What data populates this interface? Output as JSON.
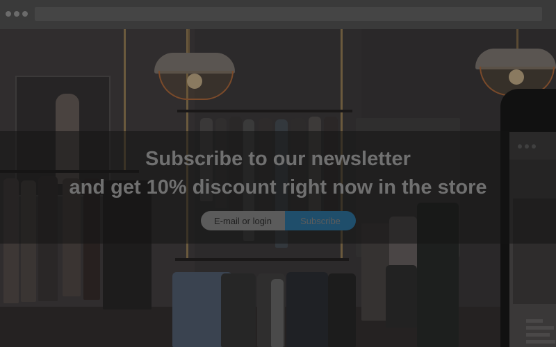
{
  "newsletter": {
    "headline_line1": "Subscribe to our newsletter",
    "headline_line2": "and get 10% discount right now in the store",
    "email_placeholder": "E-mail or login",
    "subscribe_label": "Subscribe"
  },
  "colors": {
    "subscribe_button": "#1f4e6b",
    "input_background": "#5b5b5b",
    "headline_text": "#707070"
  }
}
